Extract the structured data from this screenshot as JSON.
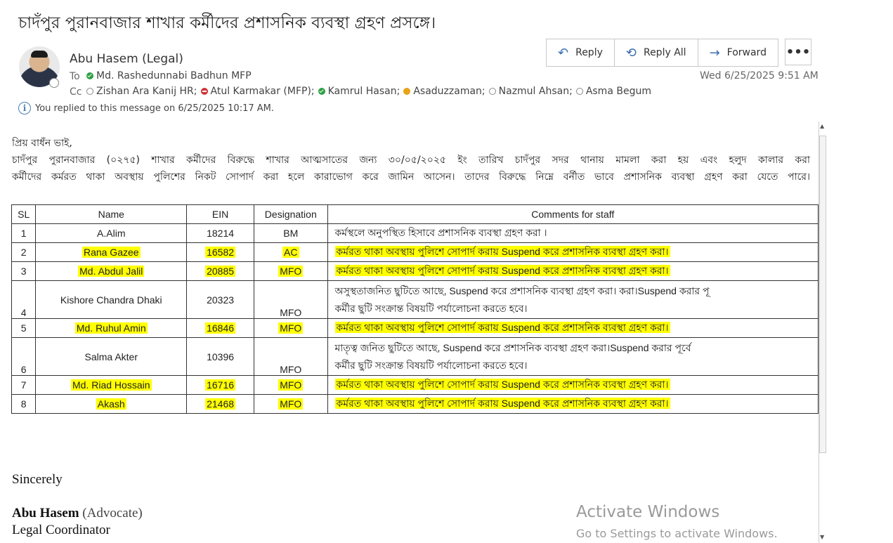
{
  "subject": "চাদঁপুর পুরানবাজার শাখার কর্মীদের প্রশাসনিক ব্যবস্থা গ্রহণ প্রসঙ্গে।",
  "sender": "Abu Hasem (Legal)",
  "to_label": "To",
  "cc_label": "Cc",
  "to": [
    {
      "name": "Md. Rashedunnabi Badhun MFP",
      "status": "available"
    }
  ],
  "cc": [
    {
      "name": "Zishan Ara Kanij HR;",
      "status": "offline"
    },
    {
      "name": "Atul  Karmakar (MFP);",
      "status": "busy"
    },
    {
      "name": "Kamrul Hasan;",
      "status": "available"
    },
    {
      "name": "Asaduzzaman;",
      "status": "away"
    },
    {
      "name": "Nazmul Ahsan;",
      "status": "offline"
    },
    {
      "name": "Asma Begum",
      "status": "offline"
    }
  ],
  "info_message": "You replied to this message on 6/25/2025 10:17 AM.",
  "actions": {
    "reply": "Reply",
    "reply_all": "Reply All",
    "forward": "Forward",
    "more": "•••"
  },
  "datetime": "Wed 6/25/2025 9:51 AM",
  "body": {
    "salutation": "প্রিয় বাধঁন ভাই,",
    "paragraph_line1": "চাদঁপুর পুরানবাজার (০২৭৫) শাখার কর্মীদের বিরুদ্ধে শাখার আত্মসাতের জন্য ৩০/০৫/২০২৫ ইং তারিখ চাদঁপুর সদর থানায় মামলা করা হয় এবং হলুদ কালার করা",
    "paragraph_line2": "কর্মীদের কর্মরত থাকা অবস্থায় পুলিশের নিকট সোপার্দ করা হলে কারাভোগ করে জামিন আসেন।  তাদের বিরুদ্ধে নিম্নে বর্নীত ভাবে প্রশাসনিক ব্যবস্থা গ্রহণ করা যেতে পারে।"
  },
  "table": {
    "headers": [
      "SL",
      "Name",
      "EIN",
      "Designation",
      "Comments for staff"
    ],
    "rows": [
      {
        "sl": "1",
        "name": "A.Alim",
        "ein": "18214",
        "designation": "BM",
        "comment": "কর্মস্থলে অনুপস্থিত হিসাবে প্রশাসনিক ব্যবস্থা গ্রহণ করা ।",
        "comment2": "",
        "highlight": false
      },
      {
        "sl": "2",
        "name": "Rana Gazee",
        "ein": "16582",
        "designation": "AC",
        "comment": "কর্মরত থাকা অবস্থায় পুলিশে সোপার্দ করায় Suspend করে প্রশাসনিক ব্যবস্থা গ্রহণ করা।",
        "comment2": "",
        "highlight": true
      },
      {
        "sl": "3",
        "name": "Md. Abdul  Jalil",
        "ein": "20885",
        "designation": "MFO",
        "comment": "কর্মরত থাকা অবস্থায় পুলিশে সোপার্দ করায় Suspend করে প্রশাসনিক ব্যবস্থা গ্রহণ করা।",
        "comment2": "",
        "highlight": true
      },
      {
        "sl": "4",
        "name": "Kishore Chandra Dhaki",
        "ein": "20323",
        "designation": "MFO",
        "comment": "অসুস্থতাজনিত ছুটিতে আছে, Suspend করে প্রশাসনিক ব্যবস্থা গ্রহণ করা। করা।Suspend করার পূ",
        "comment2": "কর্মীর  ছুটি সংক্রান্ত বিষয়টি পর্যালোচনা করতে হবে।",
        "highlight": false
      },
      {
        "sl": "5",
        "name": "Md.  Ruhul  Amin",
        "ein": "16846",
        "designation": "MFO",
        "comment": "কর্মরত থাকা অবস্থায় পুলিশে সোপার্দ করায় Suspend করে প্রশাসনিক ব্যবস্থা গ্রহণ করা।",
        "comment2": "",
        "highlight": true
      },
      {
        "sl": "6",
        "name": "Salma Akter",
        "ein": "10396",
        "designation": "MFO",
        "comment": "মাতৃত্ব জনিত ছুটিতে আছে, Suspend করে প্রশাসনিক ব্যবস্থা গ্রহণ করা।Suspend করার পূর্বে",
        "comment2": "কর্মীর  ছুটি সংক্রান্ত বিষয়টি পর্যালোচনা করতে হবে।",
        "highlight": false
      },
      {
        "sl": "7",
        "name": "Md.  Riad  Hossain",
        "ein": "16716",
        "designation": "MFO",
        "comment": "কর্মরত থাকা অবস্থায় পুলিশে সোপার্দ করায় Suspend করে প্রশাসনিক ব্যবস্থা গ্রহণ করা।",
        "comment2": "",
        "highlight": true
      },
      {
        "sl": "8",
        "name": "Akash",
        "ein": "21468",
        "designation": "MFO",
        "comment": "কর্মরত থাকা অবস্থায় পুলিশে সোপার্দ করায় Suspend করে প্রশাসনিক ব্যবস্থা গ্রহণ করা।",
        "comment2": "",
        "highlight": true
      }
    ]
  },
  "signature": {
    "closing": "Sincerely",
    "name": "Abu Hasem",
    "title_paren": "(Advocate)",
    "role": "Legal Coordinator"
  },
  "watermark": {
    "line1": "Activate Windows",
    "line2": "Go to Settings to activate Windows."
  },
  "colors": {
    "highlight": "#ffff00",
    "accent": "#3a6fb0"
  }
}
